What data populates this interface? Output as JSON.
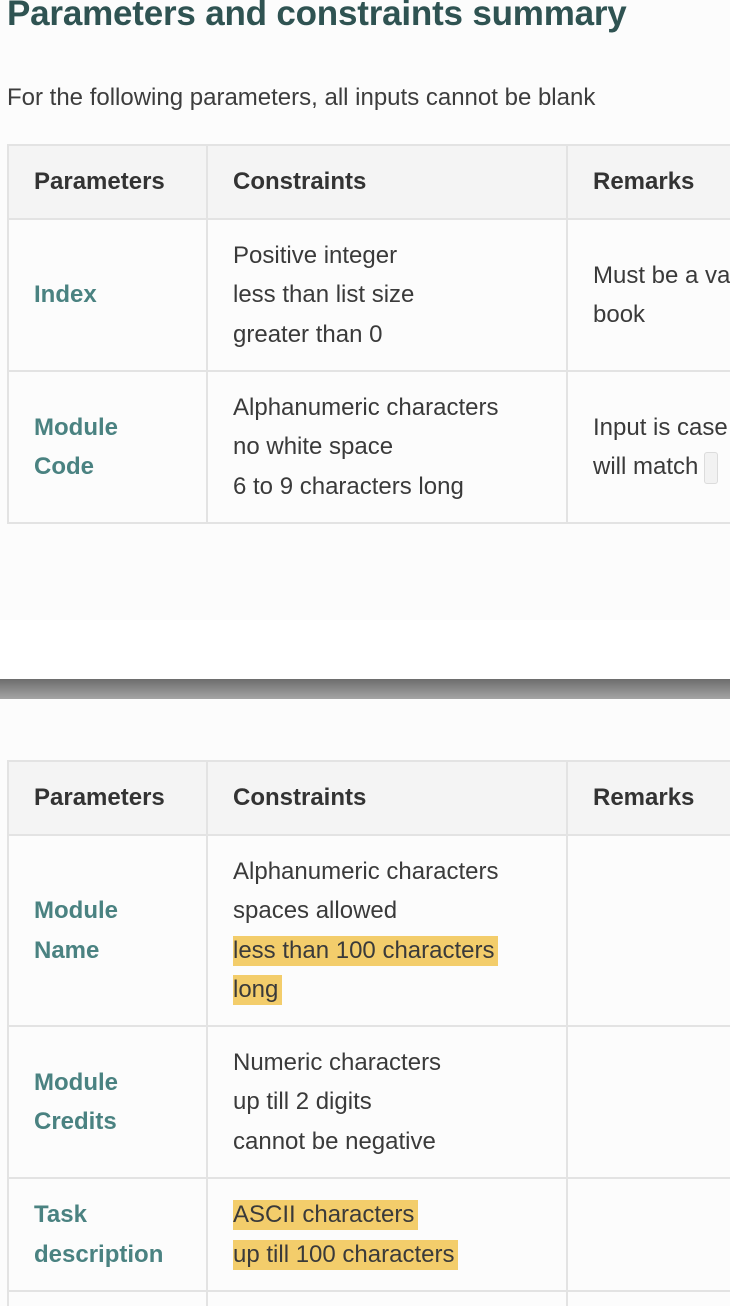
{
  "heading": "Parameters and constraints summary",
  "intro": "For the following parameters, all inputs cannot be blank",
  "table_headers": {
    "parameters": "Parameters",
    "constraints": "Constraints",
    "remarks": "Remarks"
  },
  "table1": {
    "rows": [
      {
        "param_lines": [
          "Index"
        ],
        "constraints": [
          "Positive integer",
          "less than list size",
          "greater than 0"
        ],
        "remarks": [
          "Must be a va",
          "book"
        ]
      },
      {
        "param_lines": [
          "Module",
          "Code"
        ],
        "constraints": [
          "Alphanumeric characters",
          "no white space",
          "6 to 9 characters long"
        ],
        "remarks": [
          "Input is case",
          "will match"
        ]
      }
    ]
  },
  "table2": {
    "rows": [
      {
        "param_lines": [
          "Module",
          "Name"
        ],
        "constraints": [
          "Alphanumeric characters",
          "spaces allowed",
          "less than 100 characters",
          "long"
        ],
        "highlighted": [
          2,
          3
        ]
      },
      {
        "param_lines": [
          "Module",
          "Credits"
        ],
        "constraints": [
          "Numeric characters",
          "up till 2 digits",
          "cannot be negative"
        ],
        "highlighted": []
      },
      {
        "param_lines": [
          "Task",
          "description"
        ],
        "constraints": [
          "ASCII characters",
          "up till 100 characters"
        ],
        "highlighted": [
          0,
          1
        ]
      }
    ]
  },
  "colors": {
    "heading": "#2f5352",
    "param_name": "#4a8281",
    "highlight": "#f3cd6b",
    "divider": "#7a7a7a"
  }
}
